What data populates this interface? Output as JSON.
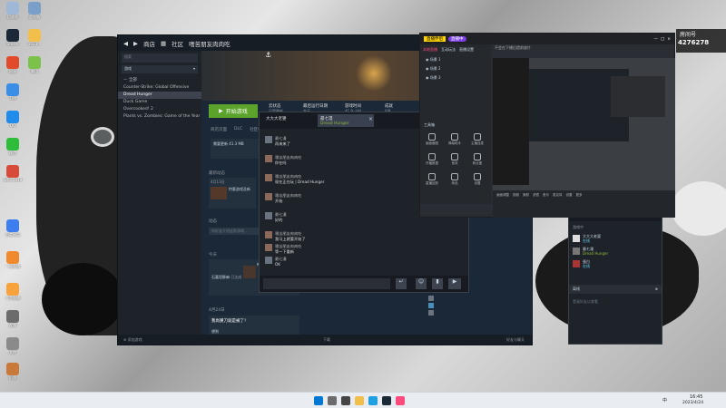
{
  "desktop": {
    "icons": [
      {
        "label": "回收站"
      },
      {
        "label": "此电脑"
      },
      {
        "label": "Steam"
      },
      {
        "label": "2023..."
      },
      {
        "label": "网易"
      },
      {
        "label": "腾讯"
      },
      {
        "label": "TIM"
      },
      {
        "label": "QQ"
      },
      {
        "label": "微信"
      },
      {
        "label": "WPS 2019"
      },
      {
        "label": "百度网盘"
      },
      {
        "label": "一键直播"
      },
      {
        "label": "斗鱼直播"
      },
      {
        "label": "视频"
      },
      {
        "label": "文件"
      },
      {
        "label": "旧版"
      }
    ]
  },
  "steam": {
    "nav": {
      "store": "商店",
      "community": "社区",
      "username": "嗜苦朋友肉肉吃"
    },
    "left": {
      "search_placeholder": "搜索",
      "filter": "游戏",
      "section_header": "— 全部",
      "games": [
        {
          "name": "Counter-Strike: Global Offensive",
          "selected": false
        },
        {
          "name": "Dread Hunger",
          "selected": true
        },
        {
          "name": "Duck Game",
          "selected": false
        },
        {
          "name": "Overcooked! 2",
          "selected": false
        },
        {
          "name": "Plants vs. Zombies: Game of the Year",
          "selected": false
        }
      ],
      "add_game": "添加游戏"
    },
    "main": {
      "play_button": "开始游戏",
      "stats": [
        {
          "title": "云状态",
          "value": "已是最新"
        },
        {
          "title": "最后运行日期",
          "value": "今天"
        },
        {
          "title": "游戏时间",
          "value": "41.9 小时"
        },
        {
          "title": "成就",
          "value": "0/8"
        }
      ],
      "tabs": [
        "商店页面",
        "DLC",
        "社区中心",
        "讨论",
        "指南",
        "支持"
      ],
      "download_notice": "需要更新 41.3 MB",
      "sections": {
        "recent": "最新动态",
        "activity": "动态",
        "friends_notes": "游戏记录",
        "today": "今天"
      },
      "news_date": "4月13日",
      "news_title": "特惠游戏及新",
      "activity_placeholder": "向好友介绍这款游戏...",
      "entry_user": "石嘉思酥麻",
      "entry_action": "已达成",
      "entry_title": "神秘的灰尘",
      "entry_date": "4月24日",
      "entry2_title": "我尚舅刀就是被了！",
      "entry2_sub": "想到"
    },
    "friends_bottom": "好友与聊天",
    "bottom_status": "下载"
  },
  "chat": {
    "tabs": [
      {
        "name": "大大大老婆",
        "active": false
      },
      {
        "name": "最七漫",
        "sub": "Dread Hunger",
        "active": true
      }
    ],
    "header_name": "最七漫",
    "header_status": "Dread Hunger",
    "messages": [
      {
        "name": "最七漫",
        "text": "再来来了"
      },
      {
        "name": "嗜苦朋友肉肉吃",
        "text": "你在吗"
      },
      {
        "name": "嗜苦朋友肉肉吃",
        "text": "现在正在玩 | Dread Hunger"
      },
      {
        "name": "嗜苦朋友肉肉吃",
        "text": "开始"
      },
      {
        "name": "最七漫",
        "text": "好的"
      },
      {
        "name": "嗜苦朋友肉肉吃",
        "text": "我马上就要开始了"
      },
      {
        "name": "嗜苦朋友肉肉吃",
        "text": "等一下重新"
      },
      {
        "name": "最七漫",
        "text": "OK"
      }
    ]
  },
  "friends_panel": {
    "title": "好友列表",
    "status": "在线",
    "online_header": "游戏中",
    "friends": [
      {
        "name": "大大大老婆",
        "status": "在线"
      },
      {
        "name": "最七漫",
        "status": "Dread Hunger"
      },
      {
        "name": "蛋白",
        "status": "在线"
      }
    ],
    "group_header": "离线",
    "footer_note": "登录好友以查看"
  },
  "stream_app": {
    "title": "直播伴侣",
    "tabs": [
      "本地直播",
      "互动玩法",
      "直播设置"
    ],
    "notice": "不会在下播后提前放片",
    "start_button": "直播中",
    "scenes": [
      "场景 1",
      "场景 2",
      "场景 3"
    ],
    "tools_header": "工具箱",
    "tools": [
      "画面截图",
      "弹幕助手",
      "主播连麦",
      "开播数据",
      "音效",
      "粉丝团",
      "直播回放",
      "商品",
      "设置"
    ],
    "bottom_buttons": [
      "画面调整",
      "视频",
      "美颜",
      "滤镜",
      "音乐",
      "麦克风",
      "设置",
      "更多"
    ],
    "viewer_count": "4276278",
    "room_label": "房间号"
  },
  "taskbar": {
    "time": "16:45",
    "date": "2023/4/24",
    "lang": "中"
  }
}
